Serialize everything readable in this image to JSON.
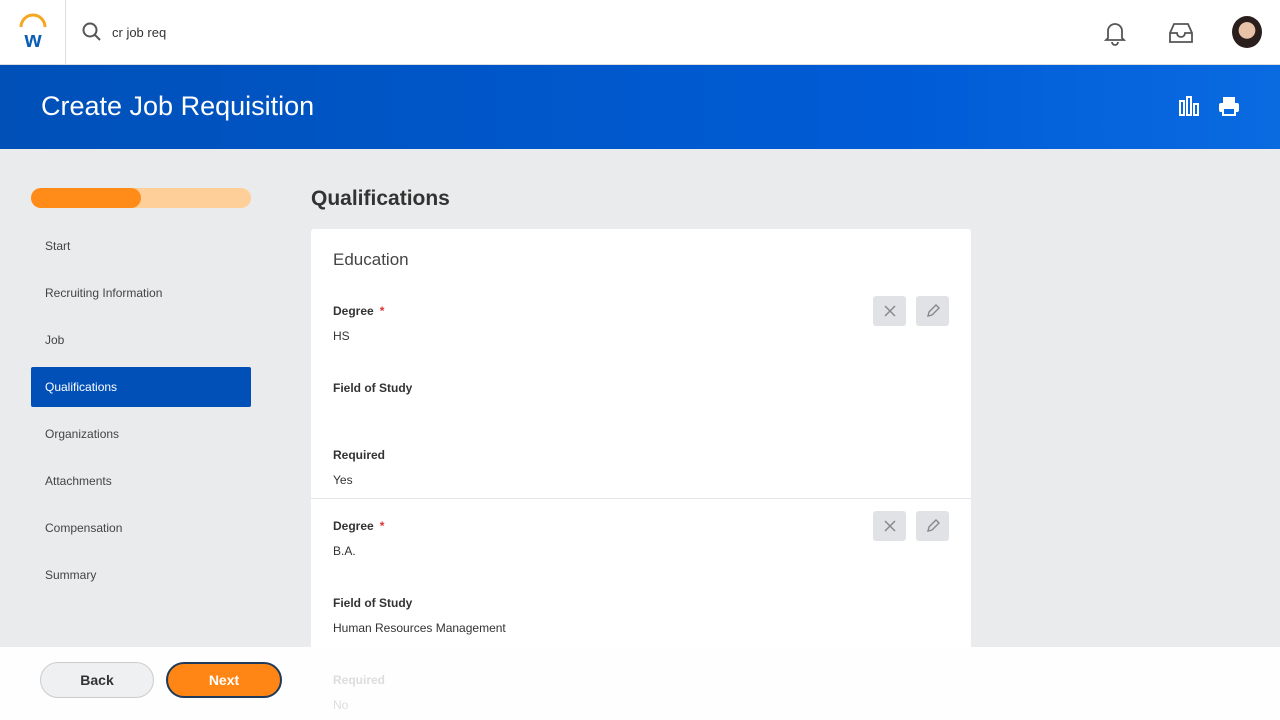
{
  "search": {
    "value": "cr job req"
  },
  "header": {
    "title": "Create Job Requisition"
  },
  "progress": {
    "percent": 50
  },
  "nav": {
    "items": [
      "Start",
      "Recruiting Information",
      "Job",
      "Qualifications",
      "Organizations",
      "Attachments",
      "Compensation",
      "Summary"
    ],
    "active": 3
  },
  "section": {
    "title": "Qualifications",
    "card_title": "Education",
    "entries": [
      {
        "degree_label": "Degree",
        "degree": "HS",
        "field_label": "Field of Study",
        "field": "",
        "required_label": "Required",
        "required": "Yes"
      },
      {
        "degree_label": "Degree",
        "degree": "B.A.",
        "field_label": "Field of Study",
        "field": "Human Resources Management",
        "required_label": "Required",
        "required": "No"
      }
    ]
  },
  "required_marker": "*",
  "footer": {
    "back": "Back",
    "next": "Next"
  },
  "colors": {
    "brand_blue": "#0050b8",
    "accent_orange": "#ff8614"
  }
}
